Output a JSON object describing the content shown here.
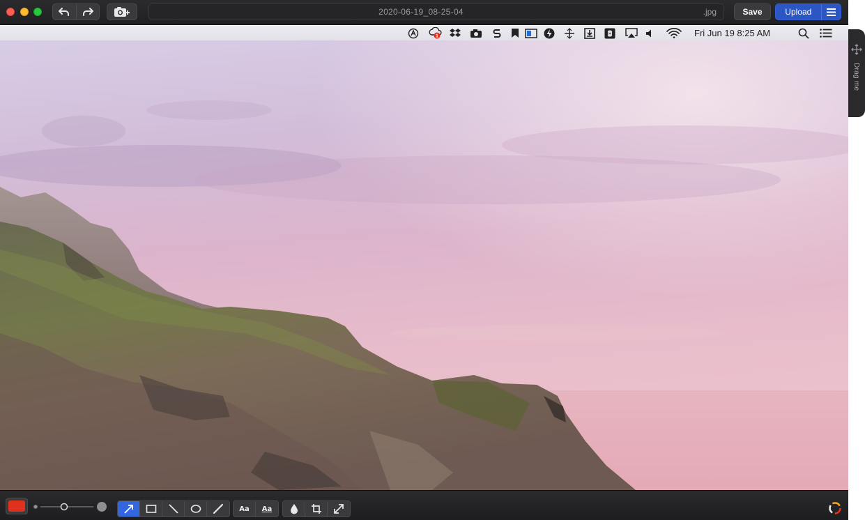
{
  "window": {
    "filename": "2020-06-19_08-25-04",
    "extension": ".jpg",
    "save_label": "Save",
    "upload_label": "Upload"
  },
  "menubar": {
    "clock": "Fri Jun 19  8:25 AM",
    "icons": [
      "app-circle-icon",
      "cloud-badge-icon",
      "dropbox-icon",
      "camera-icon",
      "s-icon",
      "bookmark-icon",
      "window-icon",
      "lightning-icon",
      "grid-icon",
      "download-icon",
      "command-icon",
      "airplay-icon",
      "volume-icon",
      "wifi-icon",
      "search-icon",
      "list-icon"
    ],
    "notification_badge": "1"
  },
  "drag_handle": {
    "label": "Drag me"
  },
  "toolbar": {
    "color": "#e0301e",
    "text_tool_label": "Aa",
    "text_style_label": "Aa",
    "active_tool": "arrow"
  },
  "colors": {
    "accent": "#3466e0",
    "upload": "#2c56c4"
  }
}
